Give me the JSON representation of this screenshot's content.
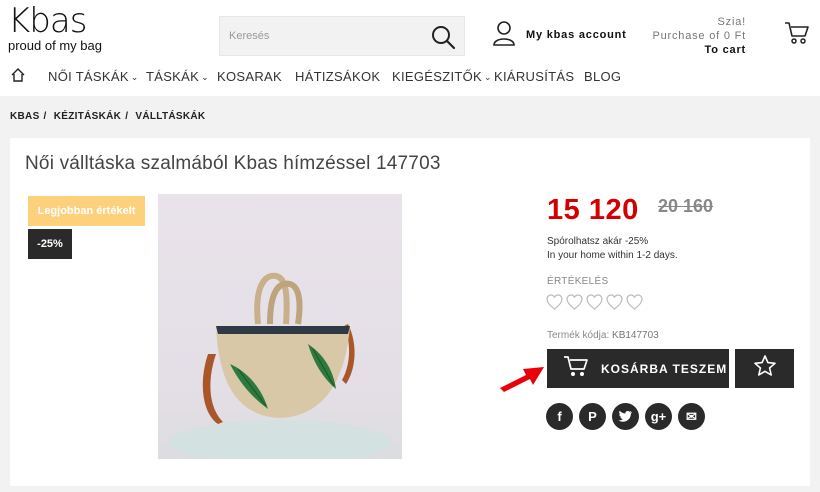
{
  "header": {
    "logo_word": "Kbas",
    "logo_tagline": "proud of my bag",
    "search_placeholder": "Keresés",
    "account_label": "My kbas account",
    "greeting": "Szia!",
    "purchase": "Purchase of 0 Ft",
    "to_cart": "To cart"
  },
  "nav": [
    {
      "label": "NŐI TÁSKÁK",
      "dropdown": true
    },
    {
      "label": "TÁSKÁK",
      "dropdown": true
    },
    {
      "label": "KOSARAK",
      "dropdown": false
    },
    {
      "label": "HÁTIZSÁKOK",
      "dropdown": false
    },
    {
      "label": "KIEGÉSZITŐK",
      "dropdown": true
    },
    {
      "label": "KIÁRUSÍTÁS",
      "dropdown": false
    },
    {
      "label": "BLOG",
      "dropdown": false
    }
  ],
  "breadcrumb": [
    "KBAS",
    "KÉZITÁSKÁK",
    "VÁLLTÁSKÁK"
  ],
  "product": {
    "title": "Női válltáska szalmából Kbas hímzéssel 147703",
    "badge_best": "Legjobban értékelt",
    "badge_discount": "-25%",
    "price_now": "15 120",
    "price_old": "20 160",
    "saving": "Spórolhatsz akár -25%",
    "delivery": "In your home within 1-2 days.",
    "rating_label": "ÉRTÉKELÉS",
    "rating_hearts": 5,
    "sku_label": "Termék kódja:",
    "sku_value": "KB147703",
    "add_to_cart": "KOSÁRBA TESZEM"
  },
  "social": [
    "facebook-icon",
    "pinterest-icon",
    "twitter-icon",
    "google-plus-icon",
    "email-icon"
  ],
  "colors": {
    "price_red": "#d40000",
    "badge_yellow": "#fdd07b",
    "button_dark": "#2a2a2a",
    "arrow_red": "#e8000a"
  }
}
